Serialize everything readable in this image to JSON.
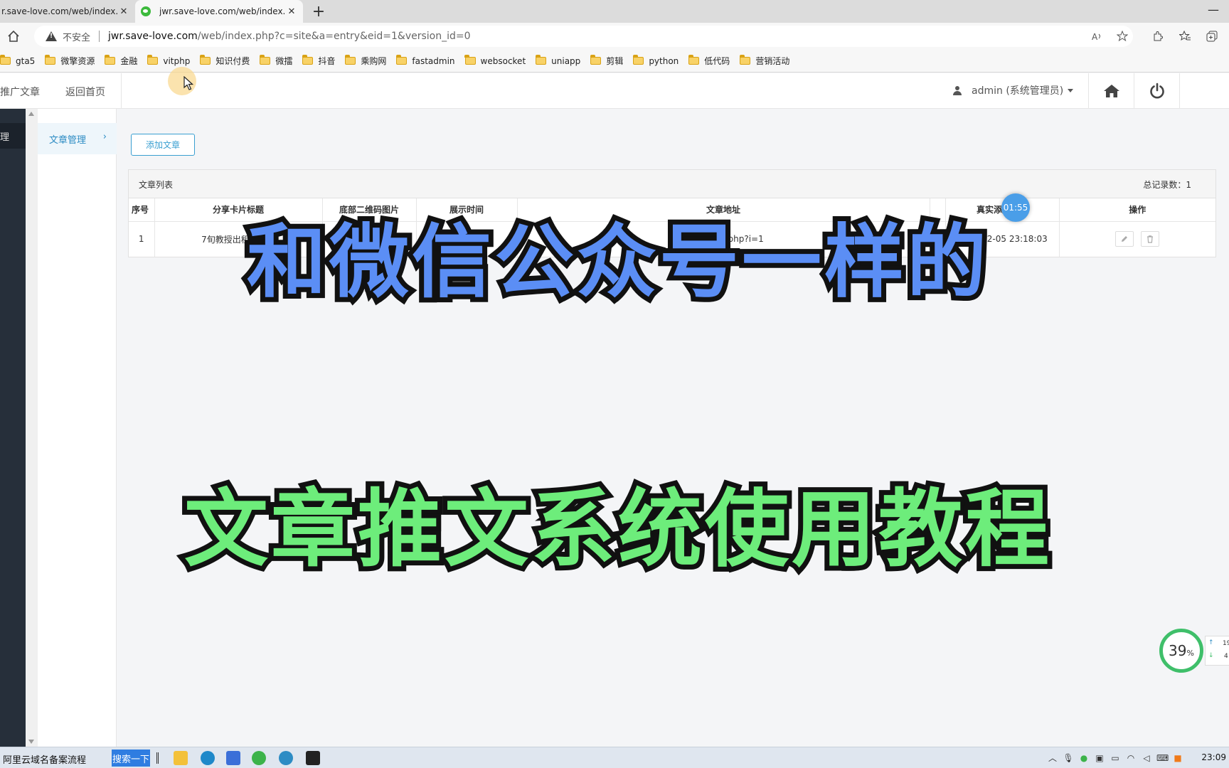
{
  "browser": {
    "tabs": [
      {
        "title": "r.save-love.com/web/index.php",
        "close": "✕"
      },
      {
        "title": "jwr.save-love.com/web/index.php",
        "close": "✕"
      }
    ],
    "new_tab": "+",
    "minimize": "—",
    "insecure_label": "不安全",
    "url_host": "jwr.save-love.com",
    "url_path": "/web/index.php?c=site&a=entry&eid=1&version_id=0",
    "bookmarks": [
      "gta5",
      "微擎资源",
      "金融",
      "vitphp",
      "知识付费",
      "微擂",
      "抖音",
      "乘购网",
      "fastadmin",
      "websocket",
      "uniapp",
      "剪辑",
      "python",
      "低代码",
      "营销活动"
    ]
  },
  "header": {
    "nav_promote": "推广文章",
    "nav_home": "返回首页",
    "user": "admin (系统管理员)"
  },
  "sidebar": {
    "dark_active": "理",
    "sub_item": "文章管理",
    "sub_chevron": "›"
  },
  "main": {
    "add_button": "添加文章",
    "panel_title": "文章列表",
    "total_label": "总记录数：1",
    "columns": [
      "序号",
      "分享卡片标题",
      "底部二维码图片",
      "展示时间",
      "文章地址",
      "",
      "真实添加时间",
      "操作"
    ],
    "row": {
      "index": "1",
      "title": "7旬教授出租屋激战",
      "url": "app/index.php?i=1",
      "added_time": "2023-02-05 23:18:03"
    }
  },
  "timer": "01:55",
  "overlay": {
    "line1": "和微信公众号一样的",
    "line2": "文章推文系统使用教程"
  },
  "speed": {
    "percent": "39",
    "unit": "%",
    "up": "19",
    "down": "4"
  },
  "taskbar": {
    "pinned_text": "阿里云域名备案流程",
    "search_btn": "搜索一下",
    "clock": "23:09"
  }
}
